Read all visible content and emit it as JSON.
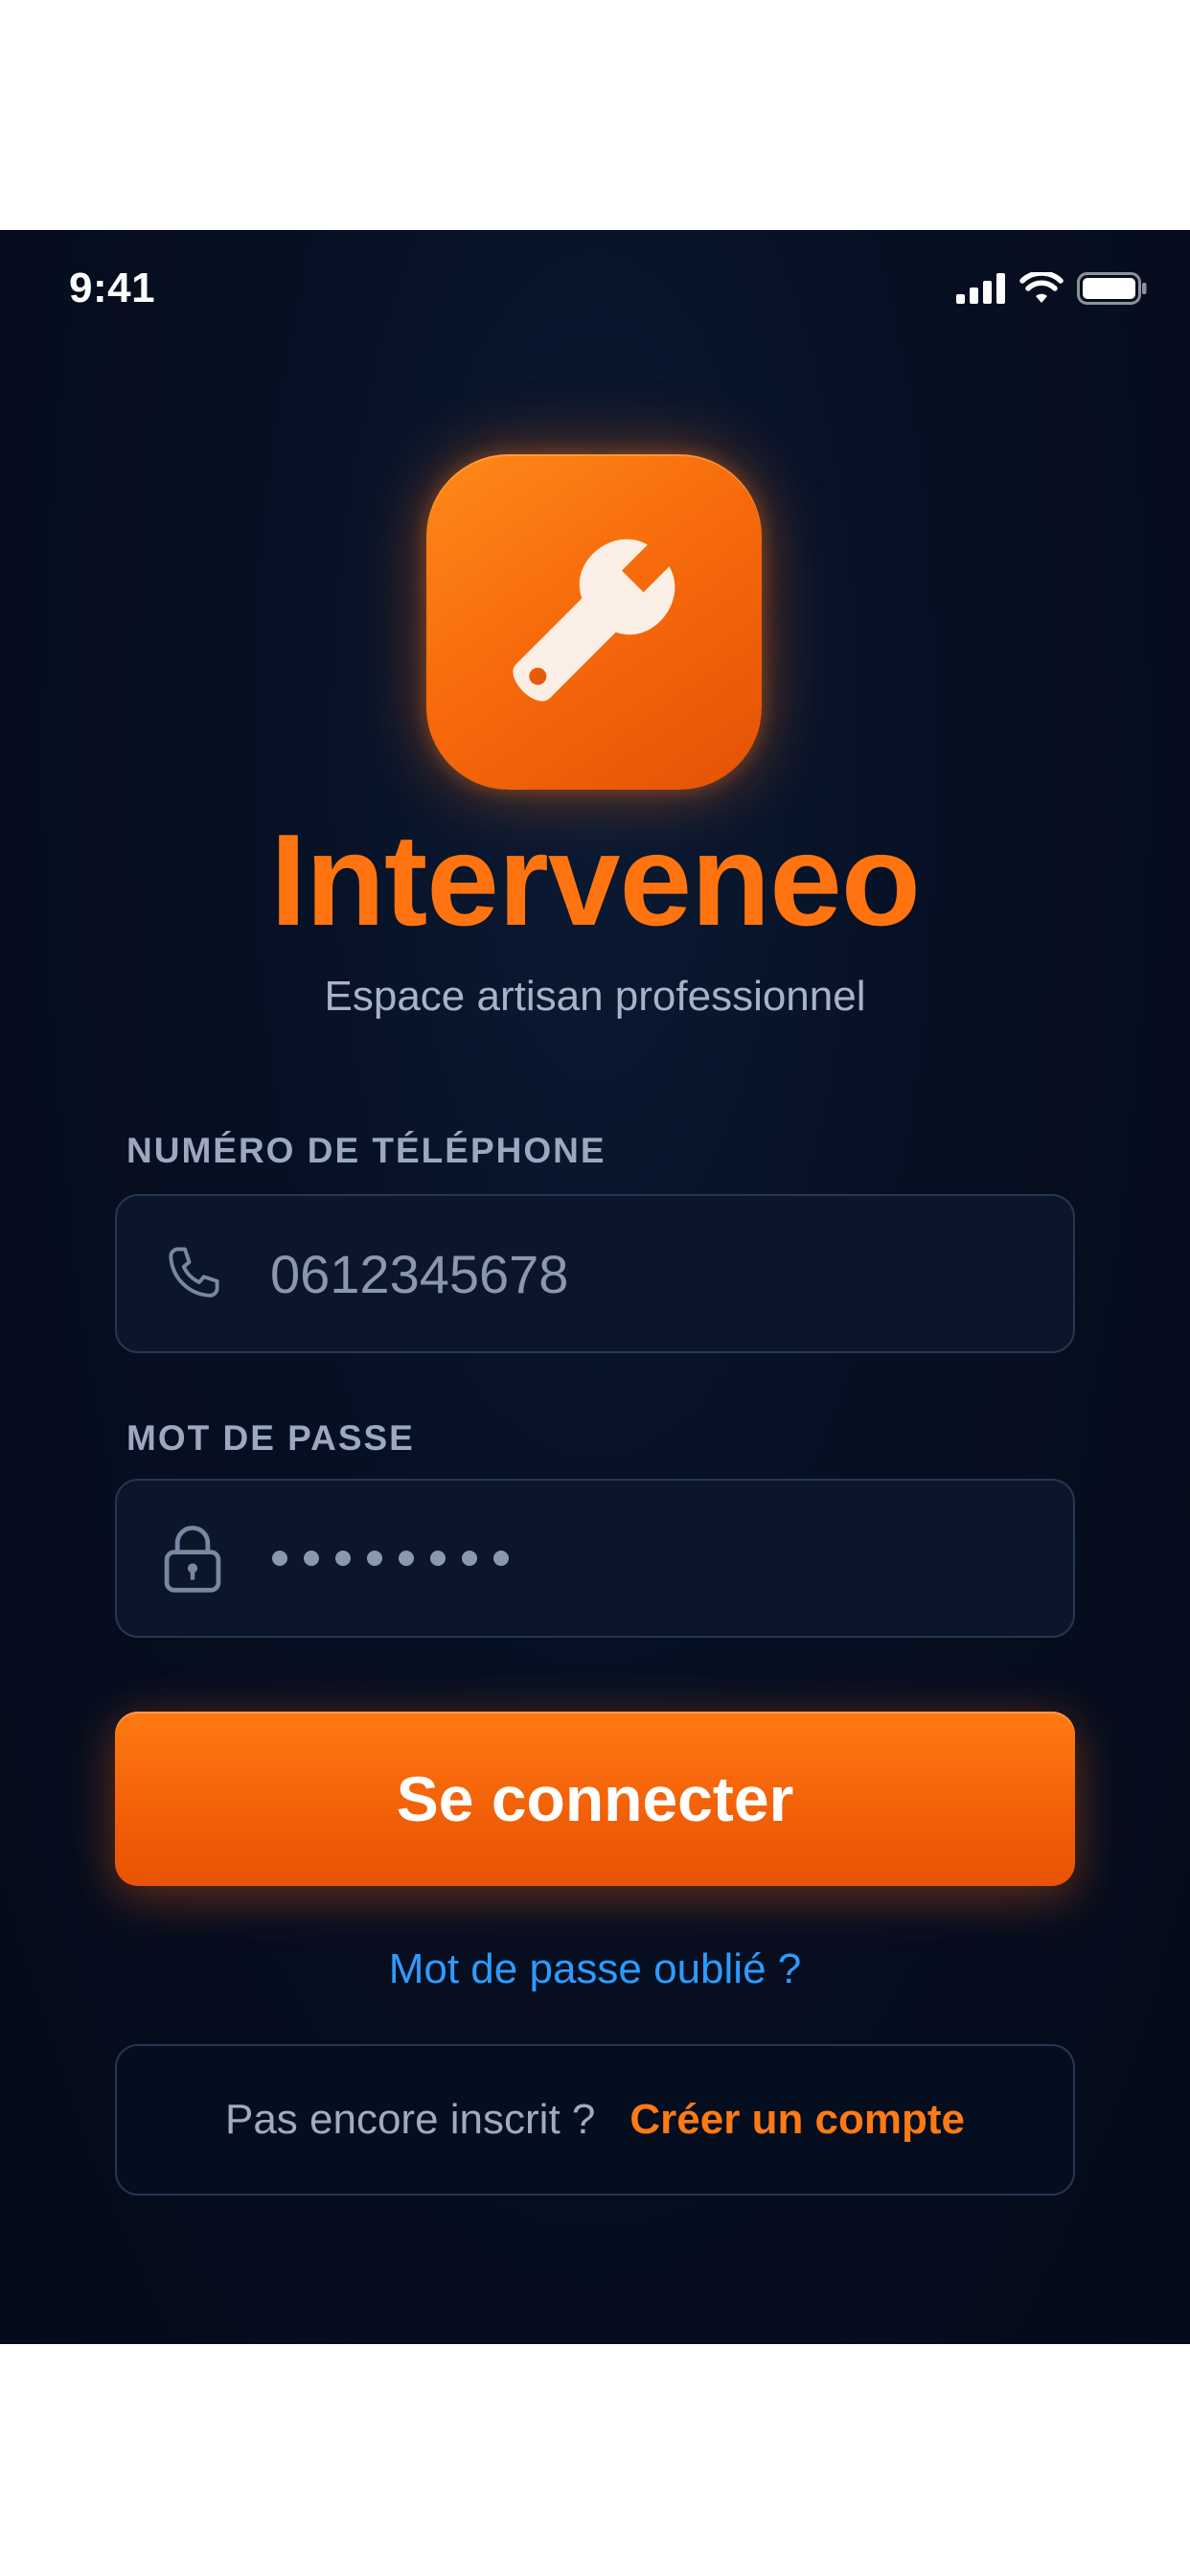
{
  "status_bar": {
    "time": "9:41"
  },
  "app": {
    "name": "Interveneo",
    "tagline": "Espace artisan professionnel",
    "logo_icon": "wrench-icon"
  },
  "form": {
    "phone": {
      "label": "NUMÉRO DE TÉLÉPHONE",
      "placeholder": "0612345678",
      "icon": "phone-icon"
    },
    "password": {
      "label": "MOT DE PASSE",
      "masked_length": 8,
      "icon": "lock-icon"
    },
    "submit_label": "Se connecter",
    "forgot_label": "Mot de passe oublié ?"
  },
  "signup": {
    "prompt": "Pas encore inscrit ?",
    "link_label": "Créer un compte"
  },
  "colors": {
    "accent": "#ff7410",
    "background": "#060f22",
    "link": "#2e9bff",
    "muted_text": "#9aa8c0"
  }
}
